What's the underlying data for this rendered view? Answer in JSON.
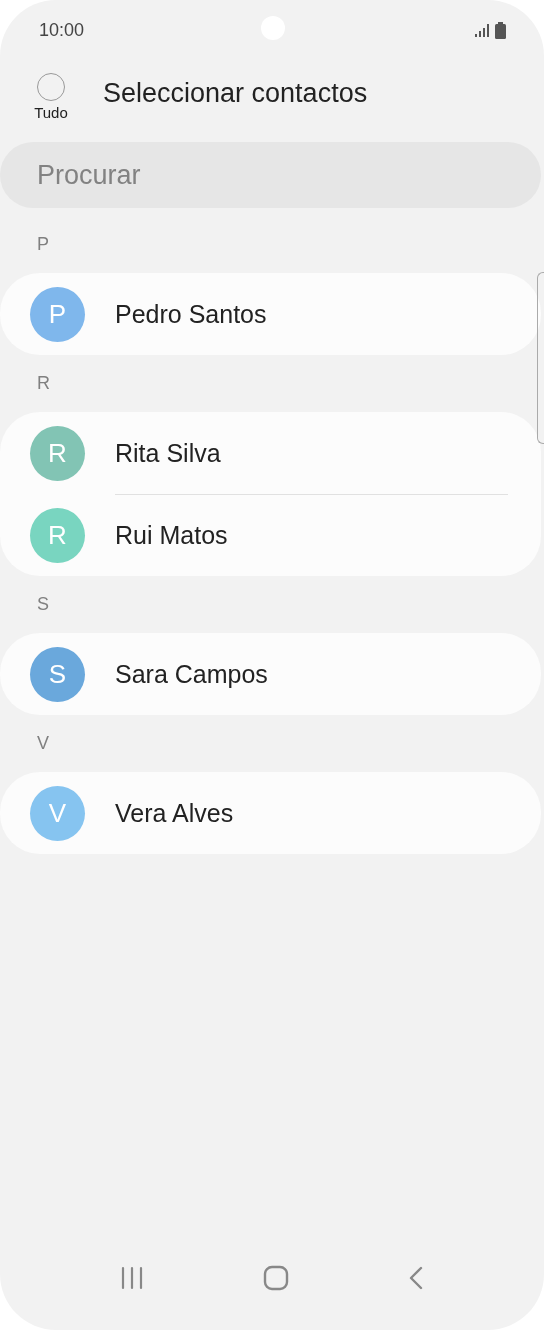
{
  "status_bar": {
    "time": "10:00"
  },
  "header": {
    "select_all": {
      "label": "Tudo",
      "checked": false
    },
    "title": "Seleccionar contactos"
  },
  "search": {
    "placeholder": "Procurar"
  },
  "sections": [
    {
      "letter": "P",
      "contacts": [
        {
          "initial": "P",
          "name": "Pedro Santos",
          "color": "#7fb7ec"
        }
      ]
    },
    {
      "letter": "R",
      "contacts": [
        {
          "initial": "R",
          "name": "Rita Silva",
          "color": "#82c4b4"
        },
        {
          "initial": "R",
          "name": "Rui Matos",
          "color": "#79d5c0"
        }
      ]
    },
    {
      "letter": "S",
      "contacts": [
        {
          "initial": "S",
          "name": "Sara Campos",
          "color": "#6aa8dc"
        }
      ]
    },
    {
      "letter": "V",
      "contacts": [
        {
          "initial": "V",
          "name": "Vera Alves",
          "color": "#86c4f0"
        }
      ]
    }
  ]
}
